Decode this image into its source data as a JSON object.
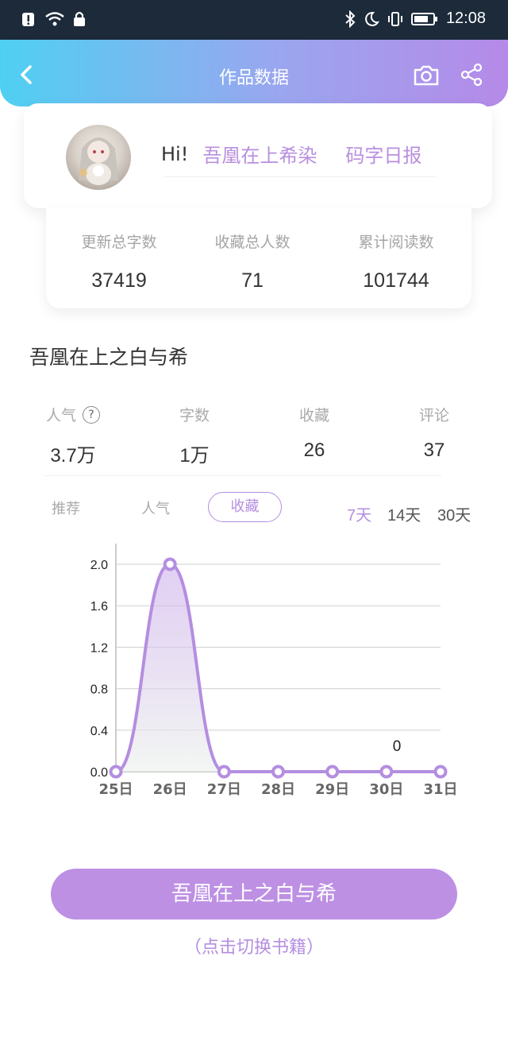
{
  "status_bar": {
    "time": "12:08"
  },
  "header": {
    "title": "作品数据"
  },
  "profile": {
    "hi": "Hi!",
    "author": "吾凰在上希染",
    "daily_report": "码字日报"
  },
  "totals": [
    {
      "label": "更新总字数",
      "value": "37419"
    },
    {
      "label": "收藏总人数",
      "value": "71"
    },
    {
      "label": "累计阅读数",
      "value": "101744"
    }
  ],
  "book": {
    "title": "吾凰在上之白与希"
  },
  "stats": [
    {
      "label": "人气",
      "value": "3.7万"
    },
    {
      "label": "字数",
      "value": "1万"
    },
    {
      "label": "收藏",
      "value": "26"
    },
    {
      "label": "评论",
      "value": "37"
    }
  ],
  "tabs": {
    "recommend": "推荐",
    "popularity": "人气",
    "favorites": "收藏"
  },
  "ranges": [
    "7天",
    "14天",
    "30天"
  ],
  "colors": {
    "accent": "#b48ee0",
    "button": "#bd90e4"
  },
  "chart_data": {
    "type": "area",
    "categories": [
      "25日",
      "26日",
      "27日",
      "28日",
      "29日",
      "30日",
      "31日"
    ],
    "values": [
      0,
      2,
      0,
      0,
      0,
      0,
      0
    ],
    "yticks": [
      "0.0",
      "0.4",
      "0.8",
      "1.2",
      "1.6",
      "2.0"
    ],
    "ylim": [
      0,
      2.0
    ],
    "annotation": "0",
    "grid": true
  },
  "bottom": {
    "button": "吾凰在上之白与希",
    "hint": "（点击切换书籍）"
  }
}
